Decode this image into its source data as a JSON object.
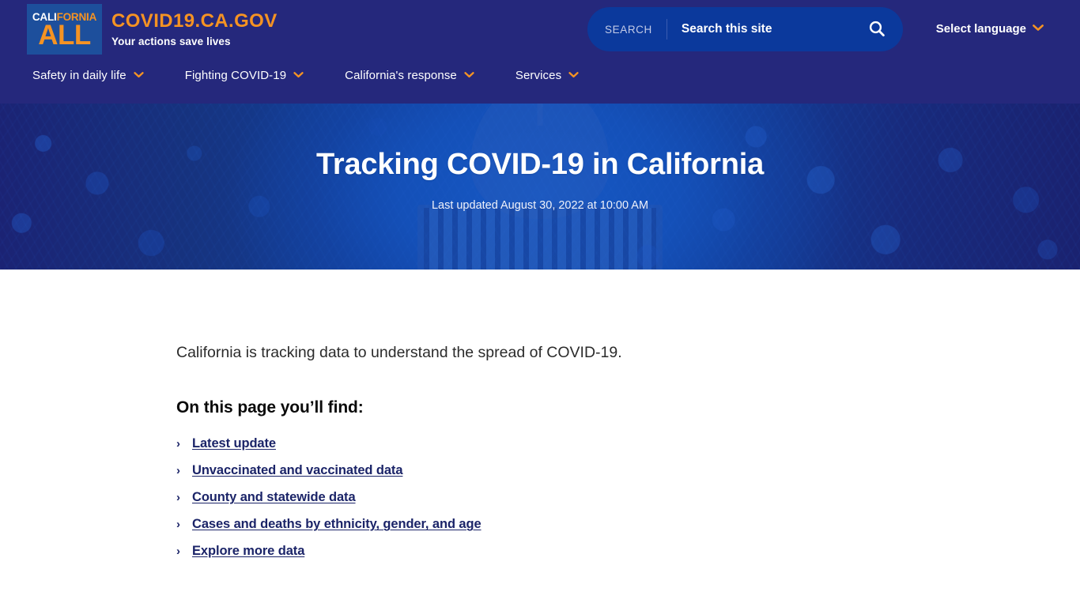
{
  "header": {
    "logo": {
      "name": "california-all-logo",
      "word_white": "CALI",
      "word_orange": "FORNIA",
      "all": "ALL"
    },
    "brand_title": "COVID19.CA.GOV",
    "brand_tagline": "Your actions save lives",
    "search": {
      "label": "SEARCH",
      "placeholder": "Search this site",
      "value": "",
      "icon": "search-icon"
    },
    "language": {
      "label": "Select language",
      "icon": "chevron-down-icon"
    },
    "nav": [
      {
        "label": "Safety in daily life",
        "icon": "chevron-down-icon"
      },
      {
        "label": "Fighting COVID-19",
        "icon": "chevron-down-icon"
      },
      {
        "label": "California's response",
        "icon": "chevron-down-icon"
      },
      {
        "label": "Services",
        "icon": "chevron-down-icon"
      }
    ]
  },
  "hero": {
    "title": "Tracking COVID-19 in California",
    "subtitle": "Last updated August 30, 2022 at 10:00 AM"
  },
  "main": {
    "lede": "California is tracking data to understand the spread of COVID-19.",
    "section_heading": "On this page you’ll find:",
    "links": [
      {
        "label": "Latest update",
        "marker": "›"
      },
      {
        "label": "Unvaccinated and vaccinated data",
        "marker": "›"
      },
      {
        "label": "County and statewide data",
        "marker": "›"
      },
      {
        "label": "Cases and deaths by ethnicity, gender, and age",
        "marker": "›"
      },
      {
        "label": "Explore more data",
        "marker": "›"
      }
    ]
  },
  "colors": {
    "header_navy": "#25287c",
    "brand_orange": "#f59323",
    "search_blue": "#0b399c",
    "hero_blue": "#0f46a8",
    "link_navy": "#1b2468",
    "logo_box_blue": "#1d4f9c"
  }
}
